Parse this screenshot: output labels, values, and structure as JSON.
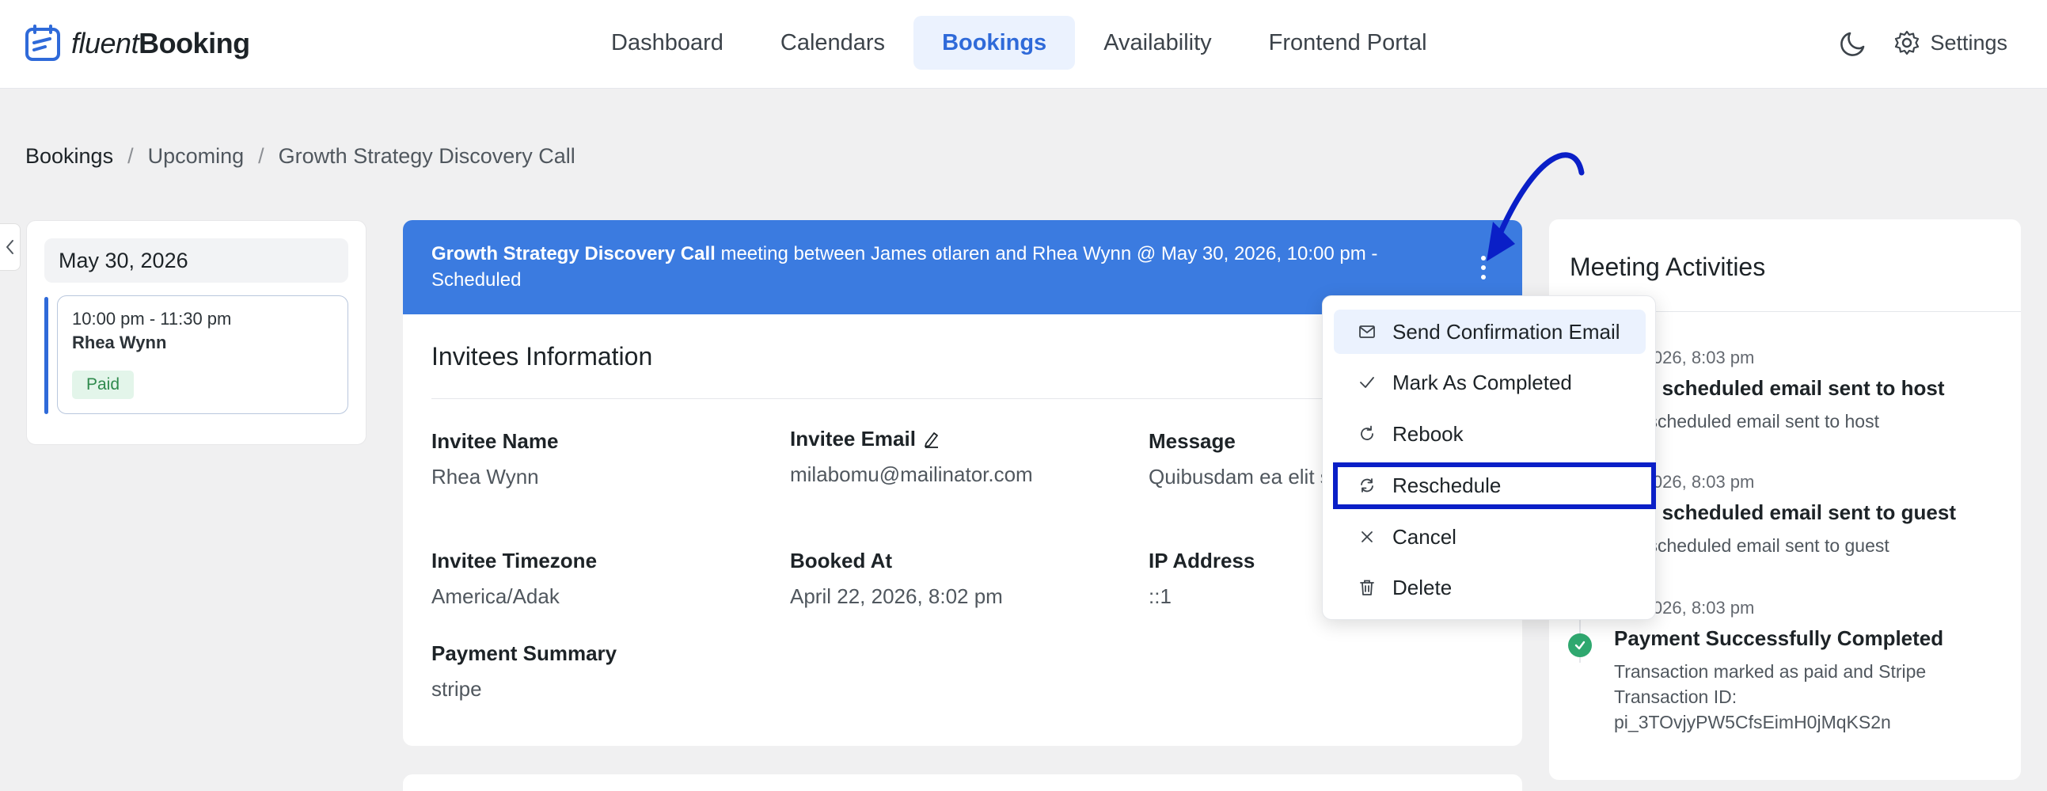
{
  "app": {
    "logo_light": "fluent",
    "logo_bold": "Booking"
  },
  "nav": {
    "items": [
      {
        "label": "Dashboard",
        "active": false
      },
      {
        "label": "Calendars",
        "active": false
      },
      {
        "label": "Bookings",
        "active": true
      },
      {
        "label": "Availability",
        "active": false
      },
      {
        "label": "Frontend Portal",
        "active": false
      }
    ],
    "settings_label": "Settings",
    "theme_icon": "moon-icon",
    "settings_icon": "gear-icon"
  },
  "breadcrumb": {
    "items": [
      "Bookings",
      "Upcoming",
      "Growth Strategy Discovery Call"
    ],
    "separator": "/"
  },
  "left_panel": {
    "date": "May 30, 2026",
    "slot": {
      "time": "10:00 pm - 11:30 pm",
      "name": "Rhea Wynn",
      "status": "Paid"
    }
  },
  "booking": {
    "header_title": "Growth Strategy Discovery Call",
    "header_rest": " meeting between James otlaren and Rhea Wynn @ May 30, 2026, 10:00 pm - Scheduled",
    "section_title": "Invitees Information",
    "fields": {
      "invitee_name": {
        "label": "Invitee Name",
        "value": "Rhea Wynn"
      },
      "invitee_email": {
        "label": "Invitee Email",
        "value": "milabomu@mailinator.com"
      },
      "message": {
        "label": "Message",
        "value": "Quibusdam ea elit s"
      },
      "invitee_timezone": {
        "label": "Invitee Timezone",
        "value": "America/Adak"
      },
      "booked_at": {
        "label": "Booked At",
        "value": "April 22, 2026, 8:02 pm"
      },
      "ip_address": {
        "label": "IP Address",
        "value": "::1"
      },
      "payment_summary": {
        "label": "Payment Summary",
        "value": "stripe"
      }
    }
  },
  "dropdown": {
    "items": [
      {
        "label": "Send Confirmation Email",
        "icon": "mail-icon"
      },
      {
        "label": "Mark As Completed",
        "icon": "check-icon"
      },
      {
        "label": "Rebook",
        "icon": "refresh-icon"
      },
      {
        "label": "Reschedule",
        "icon": "reschedule-icon"
      },
      {
        "label": "Cancel",
        "icon": "close-icon"
      },
      {
        "label": "Delete",
        "icon": "trash-icon"
      }
    ]
  },
  "activities": {
    "title": "Meeting Activities",
    "items": [
      {
        "time": "22, 2026, 8:03 pm",
        "heading": "king scheduled email sent to host",
        "detail": "ting scheduled email sent to host"
      },
      {
        "time": "22, 2026, 8:03 pm",
        "heading": "king scheduled email sent to guest",
        "detail": "ting scheduled email sent to guest"
      },
      {
        "time": "22, 2026, 8:03 pm",
        "heading": "Payment Successfully Completed",
        "detail": "Transaction marked as paid and Stripe Transaction ID: pi_3TOvjyPW5CfsEimH0jMqKS2n"
      }
    ]
  },
  "colors": {
    "primary": "#3b7be0",
    "active_nav_bg": "#ebf2fe",
    "highlight_box": "#0a1fc7",
    "success": "#2fa86f"
  }
}
